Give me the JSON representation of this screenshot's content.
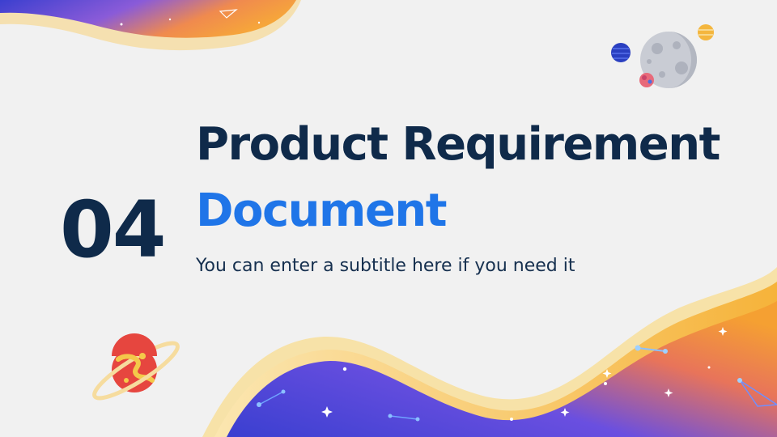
{
  "slide": {
    "number": "04",
    "title_line1": "Product Requirement",
    "title_line2": "Document",
    "subtitle": "You can enter a subtitle here if you need it"
  },
  "colors": {
    "title_dark": "#0f2a4a",
    "title_accent": "#1f75e8",
    "wave_purple": "#4a43d6",
    "wave_orange": "#f39a2c",
    "background": "#f1f1f1"
  },
  "decorations": [
    "top-left-wave",
    "bottom-wave",
    "planet-cluster-icon",
    "ringed-planet-icon",
    "star-icons",
    "constellation-icons"
  ]
}
